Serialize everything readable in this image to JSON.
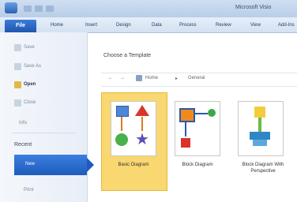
{
  "window": {
    "app_title": "Microsoft Visio"
  },
  "ribbon": {
    "file_tab": "File",
    "tabs": [
      "Home",
      "Insert",
      "Design",
      "Data",
      "Process",
      "Review",
      "View",
      "Add-Ins"
    ]
  },
  "nav": {
    "items": [
      {
        "label": "Save",
        "icon": "save-icon"
      },
      {
        "label": "Save As",
        "icon": "save-as-icon"
      },
      {
        "label": "Open",
        "icon": "open-folder-icon"
      },
      {
        "label": "Close",
        "icon": "close-doc-icon"
      },
      {
        "label": "Info"
      }
    ],
    "recent": "Recent",
    "new": "New",
    "print": "Print"
  },
  "main": {
    "heading": "Choose a Template",
    "path": {
      "back": "←",
      "forward": "→",
      "home": "Home",
      "separator": "▸",
      "current": "General"
    },
    "templates": [
      {
        "label": "Basic Diagram",
        "selected": true
      },
      {
        "label": "Block Diagram",
        "selected": false
      },
      {
        "label": "Block Diagram With Perspective",
        "selected": false
      }
    ]
  },
  "colors": {
    "accent": "#1d5bbd",
    "selection": "#f9d771"
  }
}
